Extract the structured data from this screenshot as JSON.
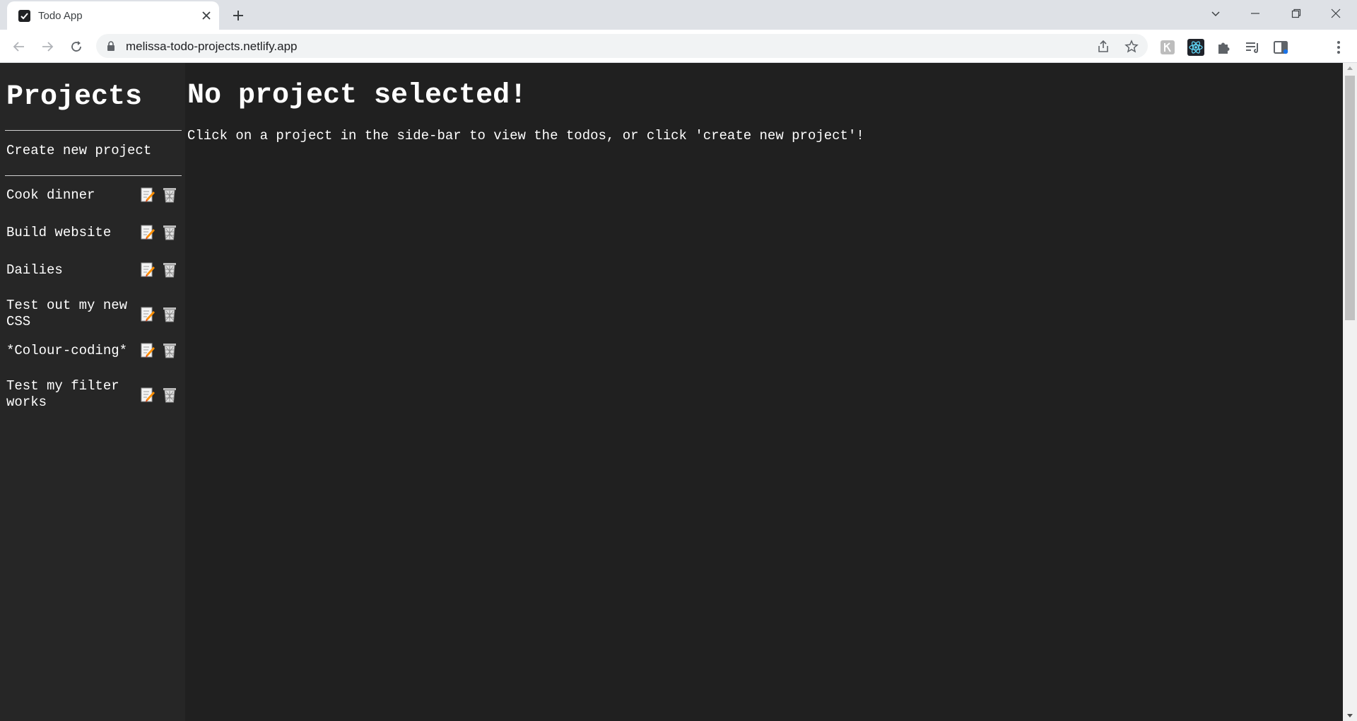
{
  "browser": {
    "tab_title": "Todo App",
    "url": "melissa-todo-projects.netlify.app"
  },
  "sidebar": {
    "title": "Projects",
    "create_label": "Create new project",
    "projects": [
      {
        "name": "Cook dinner"
      },
      {
        "name": "Build website"
      },
      {
        "name": "Dailies"
      },
      {
        "name": "Test out my new CSS"
      },
      {
        "name": "*Colour-coding*"
      },
      {
        "name": "Test my filter works"
      }
    ]
  },
  "main": {
    "heading": "No project selected!",
    "message": "Click on a project in the side-bar to view the todos, or click 'create new project'!"
  },
  "colors": {
    "page_bg": "#202020",
    "sidebar_bg": "#262626",
    "text": "#ffffff"
  }
}
